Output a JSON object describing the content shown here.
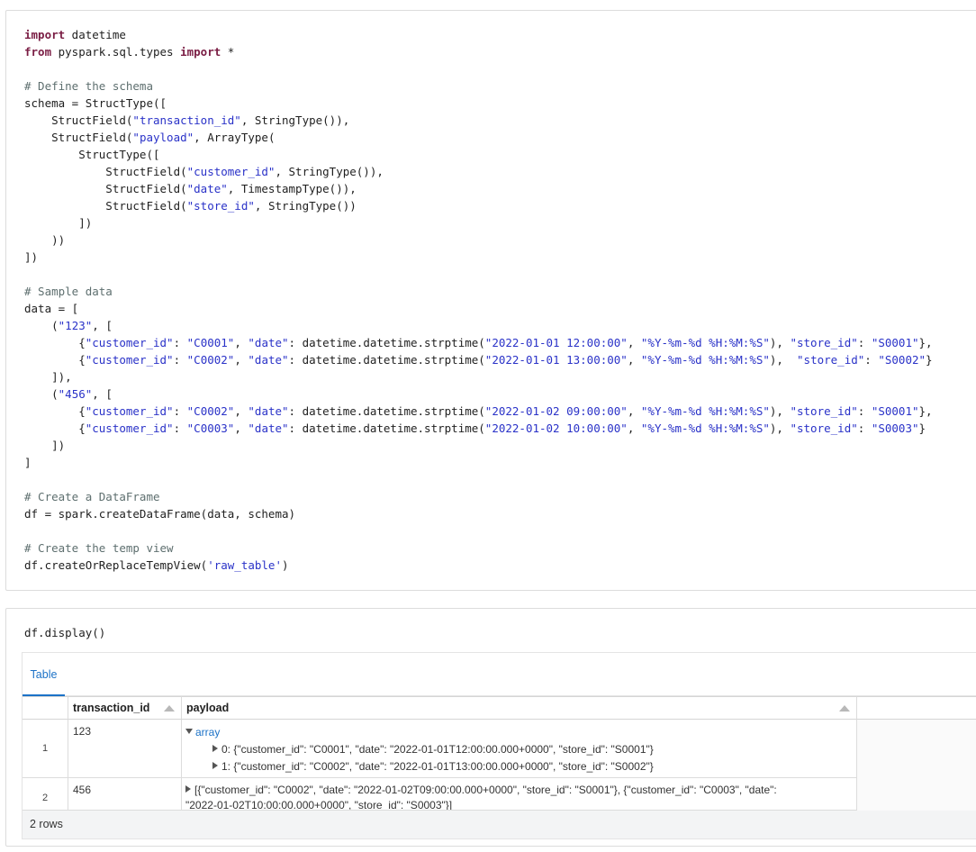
{
  "cell1": {
    "lines": [
      [
        {
          "t": "import",
          "c": "kw"
        },
        {
          "t": " datetime",
          "c": ""
        }
      ],
      [
        {
          "t": "from",
          "c": "kw"
        },
        {
          "t": " pyspark.sql.types ",
          "c": ""
        },
        {
          "t": "import",
          "c": "kw"
        },
        {
          "t": " *",
          "c": ""
        }
      ],
      [],
      [
        {
          "t": "# Define the schema",
          "c": "cm"
        }
      ],
      [
        {
          "t": "schema = StructType([",
          "c": ""
        }
      ],
      [
        {
          "t": "    StructField(",
          "c": ""
        },
        {
          "t": "\"transaction_id\"",
          "c": "st"
        },
        {
          "t": ", StringType()),",
          "c": ""
        }
      ],
      [
        {
          "t": "    StructField(",
          "c": ""
        },
        {
          "t": "\"payload\"",
          "c": "st"
        },
        {
          "t": ", ArrayType(",
          "c": ""
        }
      ],
      [
        {
          "t": "        StructType([",
          "c": ""
        }
      ],
      [
        {
          "t": "            StructField(",
          "c": ""
        },
        {
          "t": "\"customer_id\"",
          "c": "st"
        },
        {
          "t": ", StringType()),",
          "c": ""
        }
      ],
      [
        {
          "t": "            StructField(",
          "c": ""
        },
        {
          "t": "\"date\"",
          "c": "st"
        },
        {
          "t": ", TimestampType()),",
          "c": ""
        }
      ],
      [
        {
          "t": "            StructField(",
          "c": ""
        },
        {
          "t": "\"store_id\"",
          "c": "st"
        },
        {
          "t": ", StringType())",
          "c": ""
        }
      ],
      [
        {
          "t": "        ])",
          "c": ""
        }
      ],
      [
        {
          "t": "    ))",
          "c": ""
        }
      ],
      [
        {
          "t": "])",
          "c": ""
        }
      ],
      [],
      [
        {
          "t": "# Sample data",
          "c": "cm"
        }
      ],
      [
        {
          "t": "data = [",
          "c": ""
        }
      ],
      [
        {
          "t": "    (",
          "c": ""
        },
        {
          "t": "\"123\"",
          "c": "st"
        },
        {
          "t": ", [",
          "c": ""
        }
      ],
      [
        {
          "t": "        {",
          "c": ""
        },
        {
          "t": "\"customer_id\"",
          "c": "st"
        },
        {
          "t": ": ",
          "c": ""
        },
        {
          "t": "\"C0001\"",
          "c": "st"
        },
        {
          "t": ", ",
          "c": ""
        },
        {
          "t": "\"date\"",
          "c": "st"
        },
        {
          "t": ": datetime.datetime.strptime(",
          "c": ""
        },
        {
          "t": "\"2022-01-01 12:00:00\"",
          "c": "st"
        },
        {
          "t": ", ",
          "c": ""
        },
        {
          "t": "\"%Y-%m-%d %H:%M:%S\"",
          "c": "st"
        },
        {
          "t": "), ",
          "c": ""
        },
        {
          "t": "\"store_id\"",
          "c": "st"
        },
        {
          "t": ": ",
          "c": ""
        },
        {
          "t": "\"S0001\"",
          "c": "st"
        },
        {
          "t": "},",
          "c": ""
        }
      ],
      [
        {
          "t": "        {",
          "c": ""
        },
        {
          "t": "\"customer_id\"",
          "c": "st"
        },
        {
          "t": ": ",
          "c": ""
        },
        {
          "t": "\"C0002\"",
          "c": "st"
        },
        {
          "t": ", ",
          "c": ""
        },
        {
          "t": "\"date\"",
          "c": "st"
        },
        {
          "t": ": datetime.datetime.strptime(",
          "c": ""
        },
        {
          "t": "\"2022-01-01 13:00:00\"",
          "c": "st"
        },
        {
          "t": ", ",
          "c": ""
        },
        {
          "t": "\"%Y-%m-%d %H:%M:%S\"",
          "c": "st"
        },
        {
          "t": "),  ",
          "c": ""
        },
        {
          "t": "\"store_id\"",
          "c": "st"
        },
        {
          "t": ": ",
          "c": ""
        },
        {
          "t": "\"S0002\"",
          "c": "st"
        },
        {
          "t": "}",
          "c": ""
        }
      ],
      [
        {
          "t": "    ]),",
          "c": ""
        }
      ],
      [
        {
          "t": "    (",
          "c": ""
        },
        {
          "t": "\"456\"",
          "c": "st"
        },
        {
          "t": ", [",
          "c": ""
        }
      ],
      [
        {
          "t": "        {",
          "c": ""
        },
        {
          "t": "\"customer_id\"",
          "c": "st"
        },
        {
          "t": ": ",
          "c": ""
        },
        {
          "t": "\"C0002\"",
          "c": "st"
        },
        {
          "t": ", ",
          "c": ""
        },
        {
          "t": "\"date\"",
          "c": "st"
        },
        {
          "t": ": datetime.datetime.strptime(",
          "c": ""
        },
        {
          "t": "\"2022-01-02 09:00:00\"",
          "c": "st"
        },
        {
          "t": ", ",
          "c": ""
        },
        {
          "t": "\"%Y-%m-%d %H:%M:%S\"",
          "c": "st"
        },
        {
          "t": "), ",
          "c": ""
        },
        {
          "t": "\"store_id\"",
          "c": "st"
        },
        {
          "t": ": ",
          "c": ""
        },
        {
          "t": "\"S0001\"",
          "c": "st"
        },
        {
          "t": "},",
          "c": ""
        }
      ],
      [
        {
          "t": "        {",
          "c": ""
        },
        {
          "t": "\"customer_id\"",
          "c": "st"
        },
        {
          "t": ": ",
          "c": ""
        },
        {
          "t": "\"C0003\"",
          "c": "st"
        },
        {
          "t": ", ",
          "c": ""
        },
        {
          "t": "\"date\"",
          "c": "st"
        },
        {
          "t": ": datetime.datetime.strptime(",
          "c": ""
        },
        {
          "t": "\"2022-01-02 10:00:00\"",
          "c": "st"
        },
        {
          "t": ", ",
          "c": ""
        },
        {
          "t": "\"%Y-%m-%d %H:%M:%S\"",
          "c": "st"
        },
        {
          "t": "), ",
          "c": ""
        },
        {
          "t": "\"store_id\"",
          "c": "st"
        },
        {
          "t": ": ",
          "c": ""
        },
        {
          "t": "\"S0003\"",
          "c": "st"
        },
        {
          "t": "}",
          "c": ""
        }
      ],
      [
        {
          "t": "    ])",
          "c": ""
        }
      ],
      [
        {
          "t": "]",
          "c": ""
        }
      ],
      [],
      [
        {
          "t": "# Create a DataFrame",
          "c": "cm"
        }
      ],
      [
        {
          "t": "df = spark.createDataFrame(data, schema)",
          "c": ""
        }
      ],
      [],
      [
        {
          "t": "# Create the temp view",
          "c": "cm"
        }
      ],
      [
        {
          "t": "df.createOrReplaceTempView(",
          "c": ""
        },
        {
          "t": "'raw_table'",
          "c": "st"
        },
        {
          "t": ")",
          "c": ""
        }
      ]
    ]
  },
  "cell2": {
    "code": "df.display()",
    "tab_label": "Table",
    "columns": [
      "transaction_id",
      "payload"
    ],
    "rows": [
      {
        "num": "1",
        "transaction_id": "123",
        "payload_label": "array",
        "payload_items": [
          "0: {\"customer_id\": \"C0001\", \"date\": \"2022-01-01T12:00:00.000+0000\", \"store_id\": \"S0001\"}",
          "1: {\"customer_id\": \"C0002\", \"date\": \"2022-01-01T13:00:00.000+0000\", \"store_id\": \"S0002\"}"
        ]
      },
      {
        "num": "2",
        "transaction_id": "456",
        "payload_line1": "[{\"customer_id\": \"C0002\", \"date\": \"2022-01-02T09:00:00.000+0000\", \"store_id\": \"S0001\"}, {\"customer_id\": \"C0003\", \"date\":",
        "payload_line2": "\"2022-01-02T10:00:00.000+0000\", \"store_id\": \"S0003\"}]"
      }
    ],
    "footer": "2 rows"
  },
  "colors": {
    "keyword": "#7a1d44",
    "comment": "#5e6f6f",
    "string": "#2a32c8",
    "accent": "#1c72c7"
  }
}
